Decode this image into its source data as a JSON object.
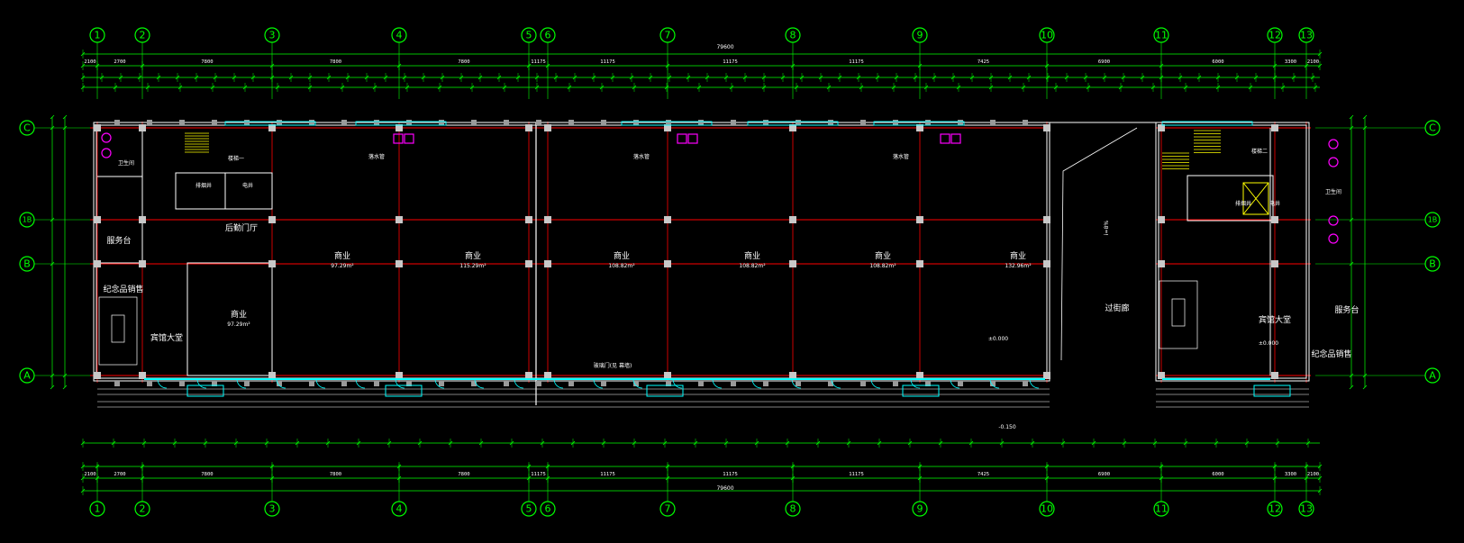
{
  "drawing": {
    "grid_columns": [
      "1",
      "2",
      "3",
      "4",
      "5",
      "6",
      "7",
      "8",
      "9",
      "10",
      "11",
      "12",
      "13"
    ],
    "grid_rows": [
      "C",
      "1B",
      "B",
      "A"
    ],
    "overall_dimension": "79600",
    "rooms": {
      "commercial": "商业",
      "passage": "过街廊",
      "lobby": "宾馆大堂",
      "shop": "纪念品销售",
      "service": "服务台",
      "back_hall": "后勤门厅",
      "toilet": "卫生间",
      "smoke_exhaust": "排烟井",
      "electric": "电井",
      "stair": "楼梯一",
      "stair2": "楼梯二"
    },
    "labels": {
      "downpipe": "落水管",
      "curtain_wall": "玻璃门(见 幕墙)",
      "slope": "i=8%",
      "elev1": "±0.000",
      "elev2": "-0.150",
      "area1": "97.29m²",
      "area2": "115.29m²",
      "area3": "108.82m²",
      "area4": "132.96m²"
    },
    "dims_top_total": [
      "2100",
      "2700",
      "7800",
      "7800",
      "7800",
      "11175",
      "11175",
      "11175",
      "11175",
      "7425",
      "6900",
      "6000",
      "3300",
      "2100"
    ],
    "colors": {
      "grid_bubble": "#00ff00",
      "red_axis": "#ff0000",
      "walls": "#ffffff",
      "columns": "#c8c8c8",
      "windows": "#00ffff",
      "downpipe": "#ff00ff",
      "dim_line": "#00ff00",
      "background": "#000000"
    }
  }
}
